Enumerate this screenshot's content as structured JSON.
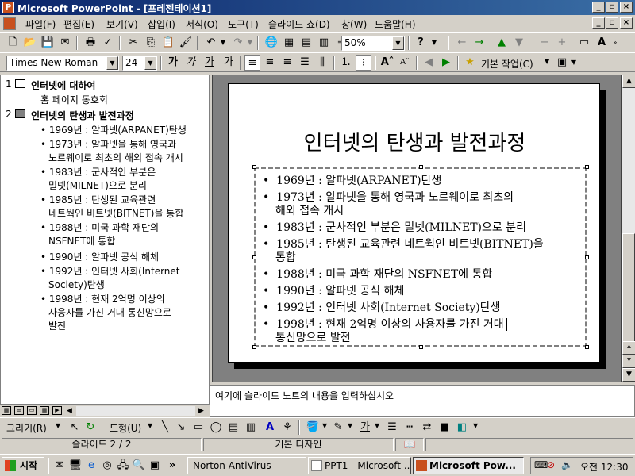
{
  "window": {
    "title": "Microsoft PowerPoint - [프레젠테이션1]",
    "app_icon": "P"
  },
  "menu": [
    "파일(F)",
    "편집(E)",
    "보기(V)",
    "삽입(I)",
    "서식(O)",
    "도구(T)",
    "슬라이드 쇼(D)",
    "창(W)",
    "도움말(H)"
  ],
  "toolbar": {
    "zoom": "50%",
    "font": "Times New Roman",
    "size": "24",
    "design_task": "기본 작업(C)"
  },
  "outline": [
    {
      "num": "1",
      "title": "인터넷에 대하여",
      "lines": [
        "홈 페이지 동호회"
      ]
    },
    {
      "num": "2",
      "title": "인터넷의 탄생과 발전과정",
      "bullets": [
        [
          "1969년 : 알파넷(ARPANET)탄생"
        ],
        [
          "1973년 : 알파넷을 통해 영국과",
          "노르웨이로 최초의 해외 접속 개시"
        ],
        [
          "1983년 : 군사적인 부분은",
          "밀넷(MILNET)으로 분리"
        ],
        [
          "1985년 : 탄생된 교육관련",
          "네트웍인 비트넷(BITNET)을 통합"
        ],
        [
          "1988년 : 미국 과학 재단의",
          "NSFNET에 통합"
        ],
        [
          "1990년 : 알파넷 공식 해체"
        ],
        [
          "1992년 : 인터넷 사회(Internet",
          "Society)탄생"
        ],
        [
          "1998년 : 현재 2억명 이상의",
          "사용자를 가진 거대 통신망으로",
          "발전"
        ]
      ]
    }
  ],
  "slide": {
    "title": "인터넷의 탄생과 발전과정",
    "bullets": [
      [
        "1969년 : 알파넷(ARPANET)탄생"
      ],
      [
        "1973년 : 알파넷을 통해 영국과 노르웨이로 최초의",
        "해외 접속 개시"
      ],
      [
        "1983년 : 군사적인 부분은 밀넷(MILNET)으로 분리"
      ],
      [
        "1985년 : 탄생된 교육관련 네트웍인 비트넷(BITNET)을",
        "통합"
      ],
      [
        "1988년 : 미국 과학 재단의 NSFNET에 통합"
      ],
      [
        "1990년 : 알파넷 공식 해체"
      ],
      [
        "1992년 : 인터넷 사회(Internet Society)탄생"
      ],
      [
        "1998년 : 현재 2억명 이상의 사용자를 가진 거대",
        "통신망으로 발전"
      ]
    ]
  },
  "notes": {
    "text": "여기에 슬라이드 노트의 내용을 입력하십시오"
  },
  "drawing": {
    "draw": "그리기(R)",
    "autoshapes": "도형(U)"
  },
  "status": {
    "slide": "슬라이드 2 / 2",
    "design": "기본 디자인"
  },
  "taskbar": {
    "start": "시작",
    "tasks": [
      "Norton AntiVirus",
      "PPT1 - Microsoft ...",
      "Microsoft Pow..."
    ],
    "clock": "오전 12:30"
  },
  "colors": {
    "title_active": "#0a246a",
    "title_gradient_end": "#3a6ea5",
    "chrome": "#d4d0c8",
    "workspace": "#808080"
  }
}
